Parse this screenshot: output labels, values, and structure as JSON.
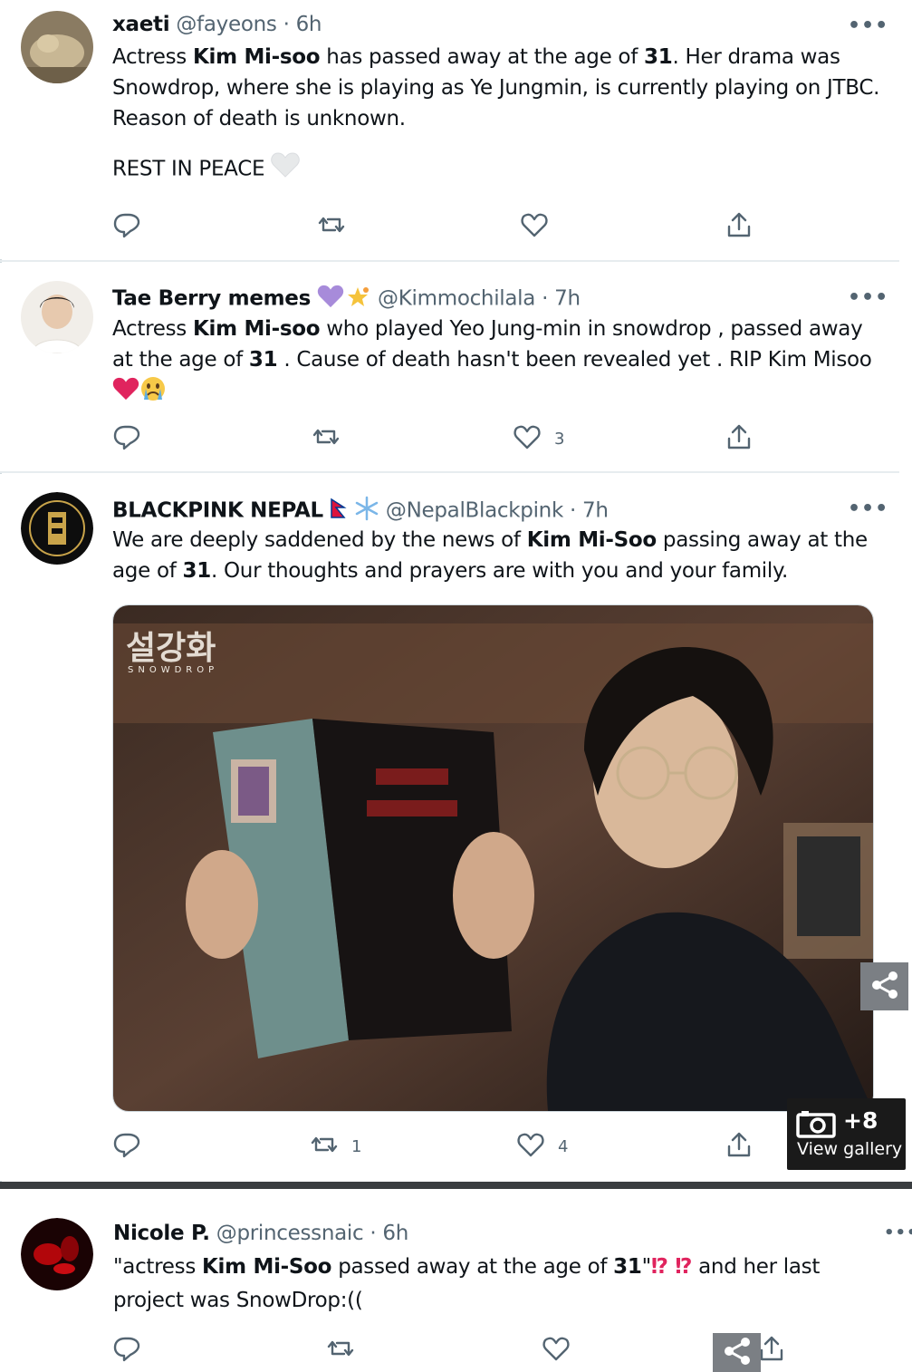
{
  "tweets": [
    {
      "name": "xaeti",
      "handle": "@fayeons",
      "sep": "·",
      "time": "6h",
      "text_a": "Actress ",
      "bold_a": "Kim Mi-soo",
      "text_b": " has passed away at the age of ",
      "bold_b": "31",
      "text_c": ". Her drama was Snowdrop, where she is playing as Ye Jungmin, is currently playing on JTBC. Reason of death is unknown.",
      "line2": "REST IN PEACE",
      "counts": {
        "reply": "",
        "retweet": "",
        "like": ""
      }
    },
    {
      "name": "Tae Berry memes",
      "handle": "@Kimmochilala",
      "sep": "·",
      "time": "7h",
      "text_a": "Actress ",
      "bold_a": "Kim Mi-soo",
      "text_b": " who played Yeo Jung-min in snowdrop , passed away at the age of ",
      "bold_b": "31",
      "text_c": " . Cause of death hasn't been revealed yet . RIP Kim Misoo",
      "counts": {
        "reply": "",
        "retweet": "",
        "like": "3"
      }
    },
    {
      "name": "BLACKPINK NEPAL",
      "handle": "@NepalBlackpink",
      "sep": "·",
      "time": "7h",
      "text_a": "We are deeply saddened by the news of ",
      "bold_a": "Kim Mi-Soo",
      "text_b": " passing away at the age of ",
      "bold_b": "31",
      "text_c": ". Our thoughts and prayers are with you and your family.",
      "media_title": "설강화",
      "media_subtitle": "SNOWDROP",
      "counts": {
        "reply": "",
        "retweet": "1",
        "like": "4"
      }
    },
    {
      "name": "Nicole P.",
      "handle": "@princessnaic",
      "sep": "·",
      "time": "6h",
      "text_a": "\"actress ",
      "bold_a": "Kim Mi-Soo",
      "text_b": " passed away at the age of ",
      "bold_b": "31",
      "text_c": "\"",
      "marks": "⁉ ⁉",
      "text_d": " and her last project was SnowDrop:((",
      "counts": {
        "reply": "",
        "retweet": "",
        "like": ""
      }
    }
  ],
  "more_label": "•••",
  "gallery": {
    "count": "+8",
    "label": "View gallery"
  },
  "colors": {
    "text": "#0f1419",
    "secondary": "#536471",
    "accent_red": "#e0245e",
    "heart_purple": "#a78bda"
  },
  "icons": [
    "reply-icon",
    "retweet-icon",
    "like-icon",
    "share-icon",
    "camera-icon",
    "share-network-icon"
  ]
}
